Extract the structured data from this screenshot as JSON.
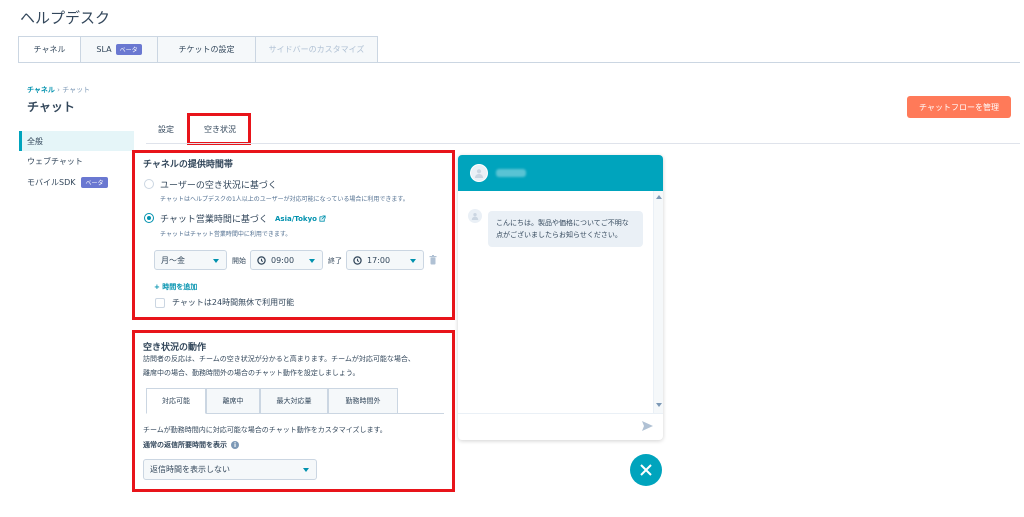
{
  "app_title": "ヘルプデスク",
  "top_tabs": [
    {
      "label": "チャネル",
      "active": true
    },
    {
      "label": "SLA",
      "badge": "ベータ"
    },
    {
      "label": "チケットの設定"
    },
    {
      "label": "サイドバーのカスタマイズ",
      "disabled": true
    }
  ],
  "breadcrumb": {
    "link": "チャネル",
    "separator": "›",
    "current": "チャット"
  },
  "page_title": "チャット",
  "flow_button": "チャットフローを管理",
  "sidebar": {
    "items": [
      {
        "label": "全般",
        "active": true
      },
      {
        "label": "ウェブチャット"
      },
      {
        "label": "モバイルSDK",
        "badge": "ベータ"
      }
    ]
  },
  "sub_tabs": [
    "設定",
    "空き状況"
  ],
  "availability": {
    "heading": "チャネルの提供時間帯",
    "option1_label": "ユーザーの空き状況に基づく",
    "option1_help": "チャットはヘルプデスクの1人以上のユーザーが対応可能になっている場合に利用できます。",
    "option2_label": "チャット営業時間に基づく",
    "timezone": "Asia/Tokyo",
    "option2_help": "チャットはチャット営業時間中に利用できます。",
    "days": "月〜金",
    "start_label": "開始",
    "start_time": "09:00",
    "end_label": "終了",
    "end_time": "17:00",
    "add_hours": "+ 時間を追加",
    "always_on_label": "チャットは24時間無休で利用可能"
  },
  "behavior": {
    "heading": "空き状況の動作",
    "desc_line1": "訪問者の反応は、チームの空き状況が分かると高まります。チームが対応可能な場合、",
    "desc_line2": "離席中の場合、勤務時間外の場合のチャット動作を設定しましょう。",
    "tabs": [
      "対応可能",
      "離席中",
      "最大対応量",
      "勤務時間外"
    ],
    "tab_desc": "チームが勤務時間内に対応可能な場合のチャット動作をカスタマイズします。",
    "reply_label": "通常の返信所要時間を表示",
    "reply_value": "返信時間を表示しない"
  },
  "chat_preview": {
    "message": "こんにちは。製品や価格についてご不明な点がございましたらお知らせください。"
  },
  "colors": {
    "accent": "#00a4bd",
    "link": "#0091ae",
    "orange": "#ff7a59",
    "highlight": "#e8141a",
    "beta": "#6a78d1"
  }
}
